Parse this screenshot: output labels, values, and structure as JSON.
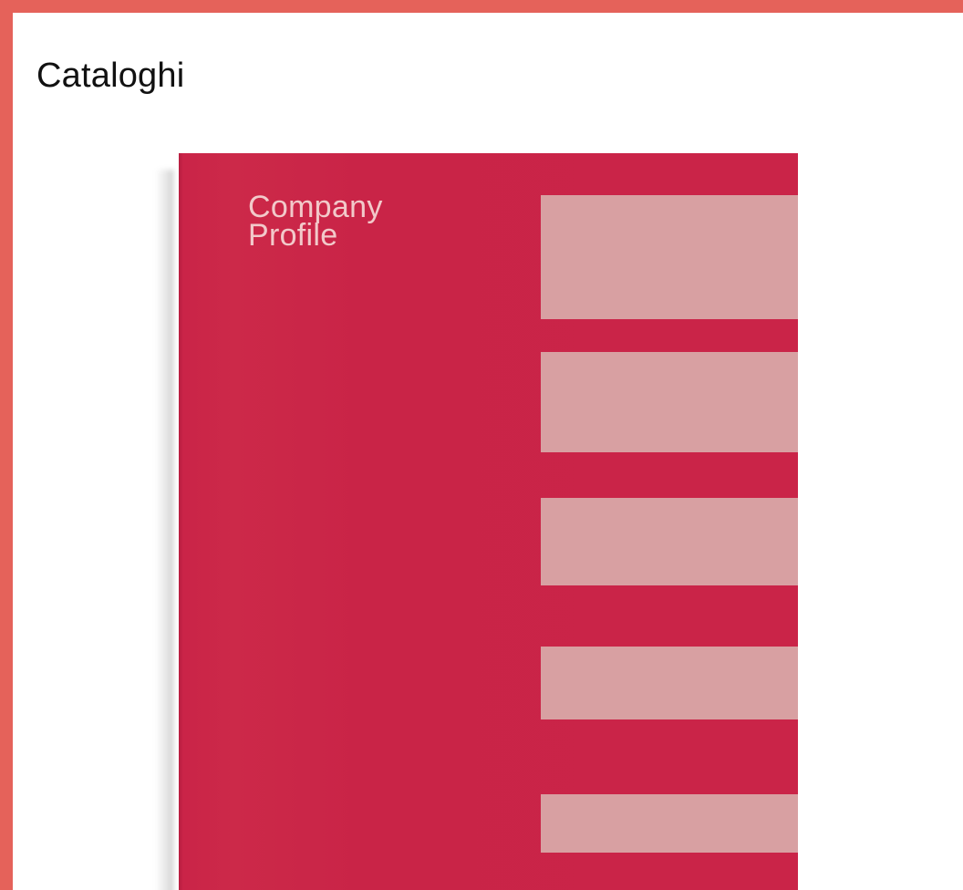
{
  "section": {
    "title": "Cataloghi"
  },
  "catalog_image": {
    "cover_title_line1": "Company",
    "cover_title_line2": "Profile"
  },
  "colors": {
    "page_border": "#E5625A",
    "card_background": "#FFFFFF",
    "cover_red": "#CA2448",
    "cover_stripes": "#D8A0A2",
    "cover_text": "#F2C9CA"
  }
}
